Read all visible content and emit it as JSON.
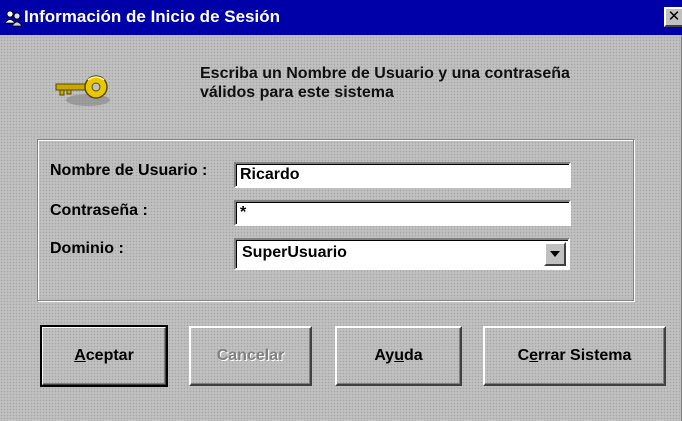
{
  "window": {
    "title": "Información de Inicio de Sesión",
    "close_glyph": "✕",
    "title_icon": "users-icon"
  },
  "header": {
    "icon": "key-icon",
    "instruction_line1": "Escriba un Nombre de Usuario y una contraseña",
    "instruction_line2": "válidos para este sistema"
  },
  "form": {
    "username_label": "Nombre de Usuario :",
    "username_value": "Ricardo",
    "password_label": "Contraseña :",
    "password_value": "*",
    "domain_label": "Dominio :",
    "domain_value": "SuperUsuario"
  },
  "buttons": {
    "accept": {
      "label_prefix": "",
      "mnemonic": "A",
      "label_rest": "ceptar"
    },
    "cancel": {
      "label": "Cancelar",
      "enabled": false
    },
    "help": {
      "label_prefix": "Ay",
      "mnemonic": "u",
      "label_rest": "da"
    },
    "close_system": {
      "label_prefix": "C",
      "mnemonic": "e",
      "label_rest": "rrar Sistema"
    }
  },
  "colors": {
    "titlebar": "#0000a8",
    "face": "#c0c0c0",
    "disabled_text": "#808080"
  }
}
